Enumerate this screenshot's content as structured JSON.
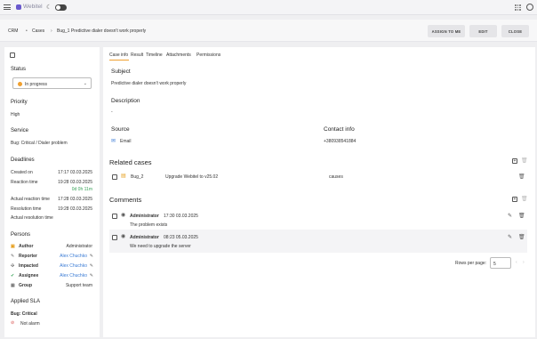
{
  "app": {
    "logo_text": "Webitel"
  },
  "breadcrumb": {
    "root": "CRM",
    "section": "Cases",
    "current": "Bug_1 Predictive dialer doesn't work properly"
  },
  "actions": {
    "assign": "ASSIGN TO ME",
    "edit": "EDIT",
    "close": "CLOSE"
  },
  "left": {
    "status_title": "Status",
    "status_value": "In progress",
    "priority_title": "Priority",
    "priority_value": "High",
    "service_title": "Service",
    "service_value": "Bug: Critical / Dialer problem",
    "deadlines_title": "Deadlines",
    "deadlines": [
      {
        "label": "Created on",
        "value": "17:17 03.03.2025"
      },
      {
        "label": "Reaction time",
        "value": "19:28 03.03.2025",
        "sub": "0d 0h 11m"
      },
      {
        "label": "Actual reaction time",
        "value": "17:28 03.03.2025"
      },
      {
        "label": "Resolution time",
        "value": "19:28 03.03.2025"
      },
      {
        "label": "Actual resolution time",
        "value": ""
      }
    ],
    "persons_title": "Persons",
    "persons": [
      {
        "role": "Author",
        "name": "Administrator"
      },
      {
        "role": "Reporter",
        "name": "Alex Chuchko"
      },
      {
        "role": "Impacted",
        "name": "Alex Chuchko"
      },
      {
        "role": "Assignee",
        "name": "Alex Chuchko"
      },
      {
        "role": "Group",
        "name": "Support team"
      }
    ],
    "sla_title": "Applied SLA",
    "sla_name": "Bug: Critical",
    "sla_alarm": "Not alarm"
  },
  "tabs": [
    "Case info",
    "Result",
    "Timeline",
    "Attachments",
    "Permissions"
  ],
  "info": {
    "subject_title": "Subject",
    "subject": "Predictive dialer doesn't work properly",
    "description_title": "Description",
    "description": "-",
    "source_title": "Source",
    "source": "Email",
    "contact_title": "Contact info",
    "contact": "+380938541884"
  },
  "related": {
    "title": "Related cases",
    "rows": [
      {
        "id": "Bug_2",
        "subject": "Upgrade Webitel to v25.02",
        "relation": "causes"
      }
    ]
  },
  "comments": {
    "title": "Comments",
    "items": [
      {
        "author": "Administrator",
        "time": "17:30 03.03.2025",
        "text": "The problem exists"
      },
      {
        "author": "Administrator",
        "time": "08:23 05.03.2025",
        "text": "We need to upgrade the server"
      }
    ],
    "rows_per_page_label": "Rows per page:",
    "rows_per_page": "5"
  },
  "colors": {
    "accent": "#f0a030",
    "link": "#3a7bd5",
    "green": "#3aa35a",
    "alarm": "#d9534f"
  }
}
